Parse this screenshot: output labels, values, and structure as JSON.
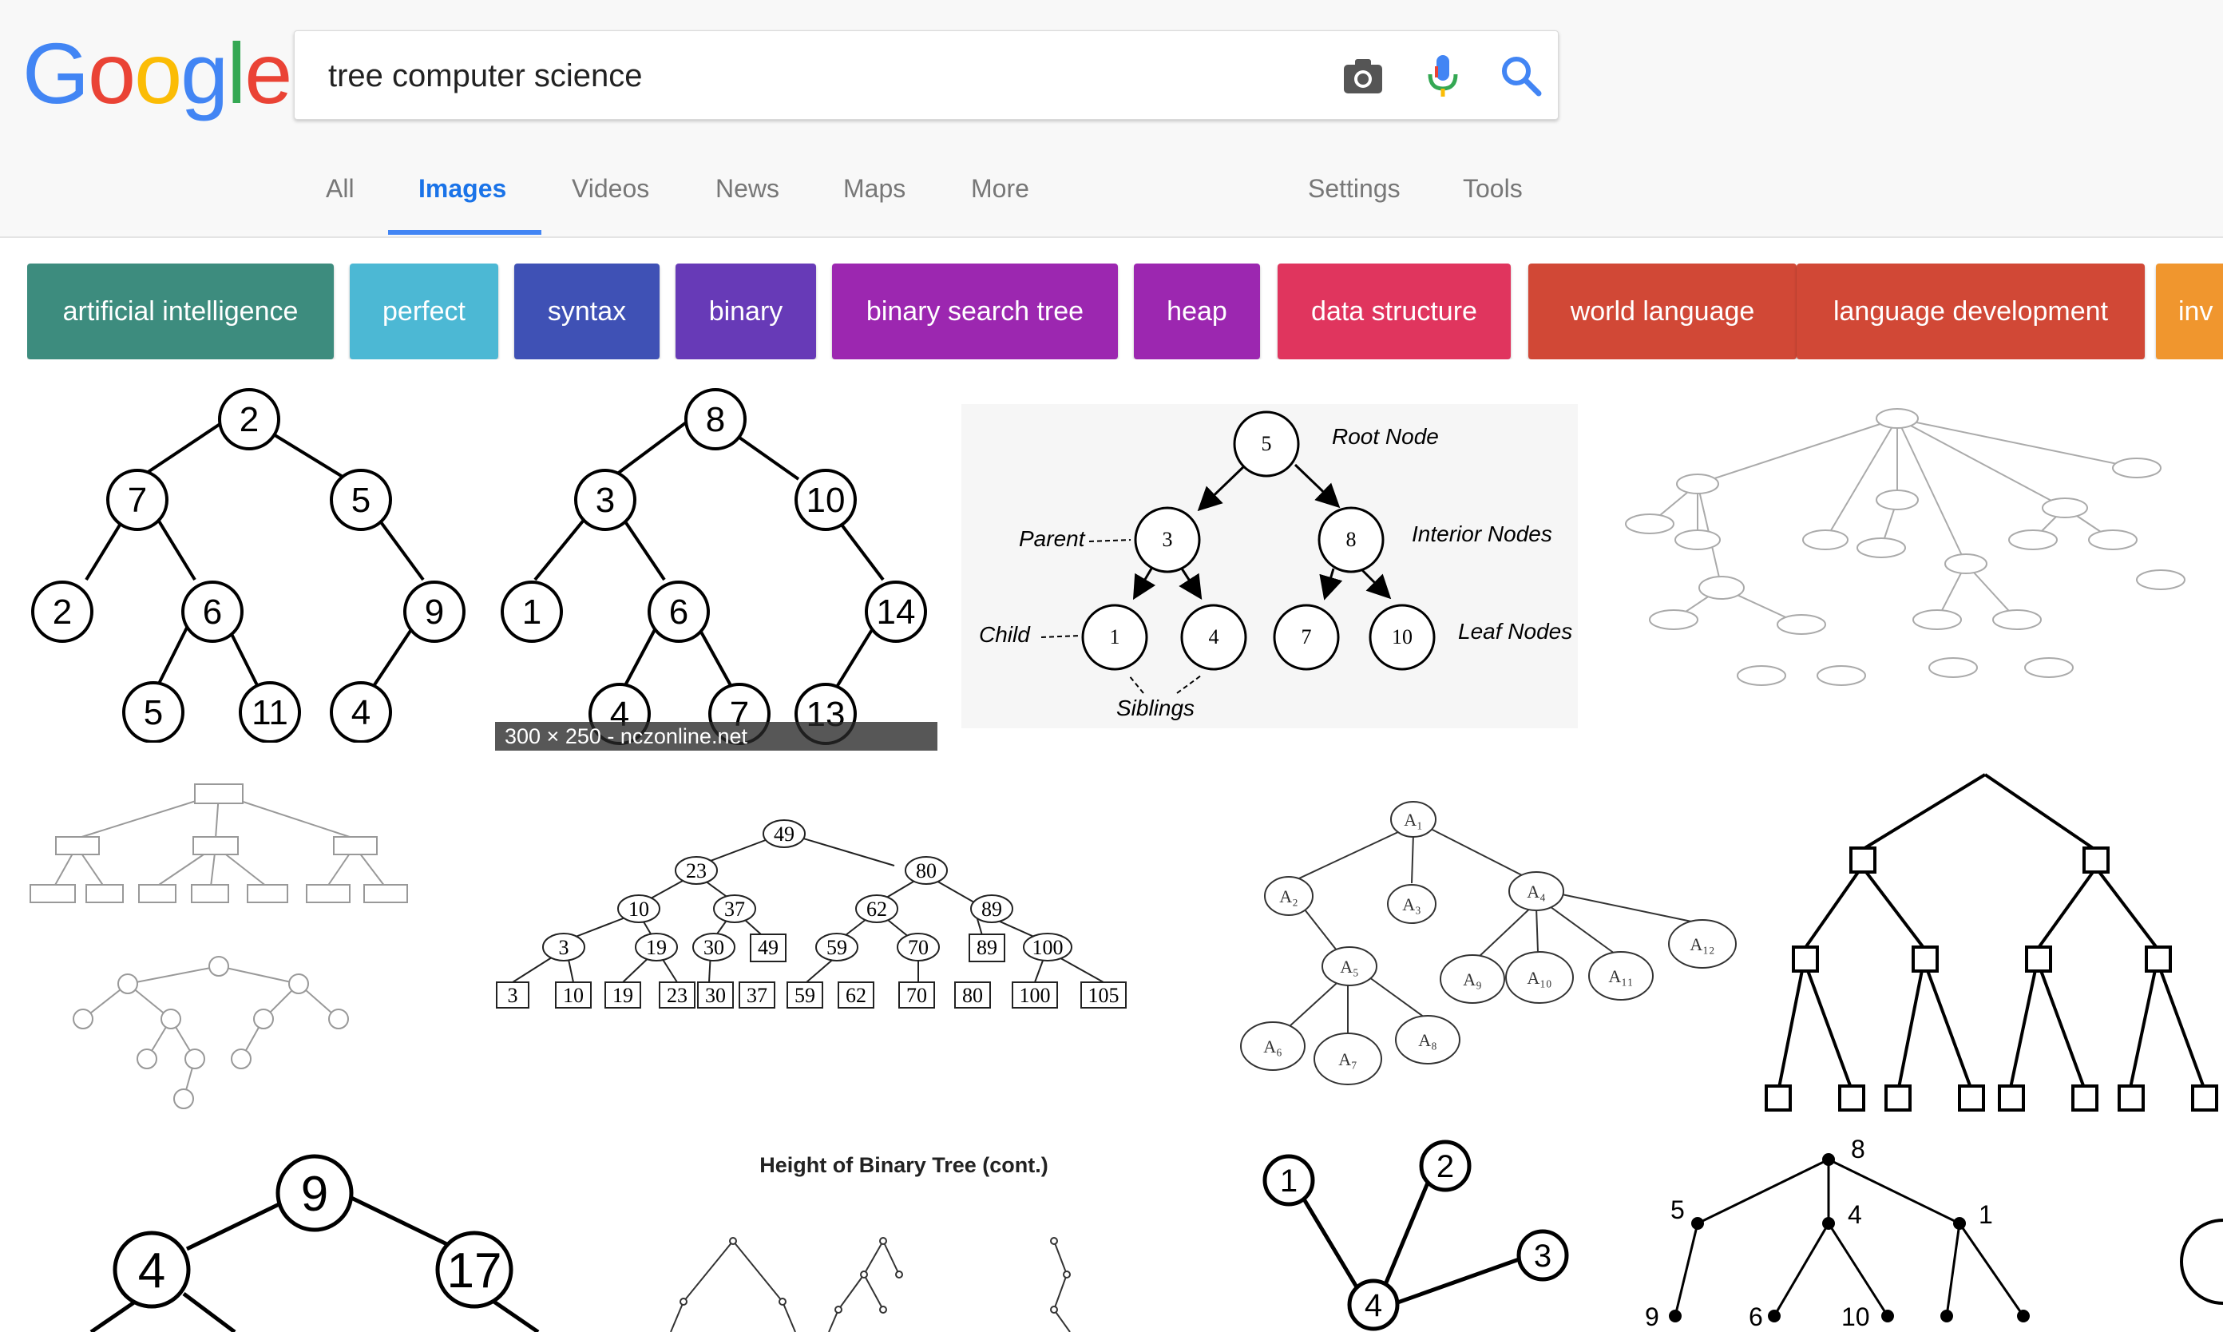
{
  "logo": {
    "letters": [
      "G",
      "o",
      "o",
      "g",
      "l",
      "e"
    ],
    "colors": [
      "#4285f4",
      "#ea4335",
      "#fbbc05",
      "#4285f4",
      "#34a853",
      "#ea4335"
    ]
  },
  "search": {
    "query": "tree computer science",
    "icons": [
      "camera-icon",
      "microphone-icon",
      "search-icon"
    ]
  },
  "tabs": {
    "all": "All",
    "images": "Images",
    "videos": "Videos",
    "news": "News",
    "maps": "Maps",
    "more": "More",
    "settings": "Settings",
    "tools": "Tools",
    "active": "Images"
  },
  "chips": [
    {
      "label": "artificial intelligence",
      "color": "#3d8c7e"
    },
    {
      "label": "perfect",
      "color": "#4cb8d4"
    },
    {
      "label": "syntax",
      "color": "#3f51b5"
    },
    {
      "label": "binary",
      "color": "#673ab7"
    },
    {
      "label": "binary search tree",
      "color": "#9c27b0"
    },
    {
      "label": "heap",
      "color": "#9c27b0"
    },
    {
      "label": "data structure",
      "color": "#e0355e"
    },
    {
      "label": "world language",
      "color": "#d14836"
    },
    {
      "label": "language development",
      "color": "#d14836"
    },
    {
      "label": "inv",
      "color": "#f0962e"
    }
  ],
  "results": {
    "hover_info": "300 × 250 - nczonline.net",
    "tree1": {
      "nodes": [
        "2",
        "7",
        "5",
        "2",
        "6",
        "9",
        "5",
        "11",
        "4"
      ]
    },
    "tree2": {
      "nodes": [
        "8",
        "3",
        "10",
        "1",
        "6",
        "14",
        "4",
        "7",
        "13"
      ]
    },
    "tree3": {
      "nodes": [
        "5",
        "3",
        "8",
        "1",
        "4",
        "7",
        "10"
      ],
      "labels": {
        "root": "Root Node",
        "interior": "Interior Nodes",
        "leaf": "Leaf Nodes",
        "parent": "Parent",
        "child": "Child",
        "siblings": "Siblings"
      }
    },
    "tree6": {
      "nodes": [
        "49",
        "23",
        "80",
        "10",
        "37",
        "62",
        "89",
        "3",
        "19",
        "30",
        "49",
        "59",
        "70",
        "89",
        "100"
      ],
      "leaves": [
        "3",
        "10",
        "19",
        "23",
        "30",
        "37",
        "59",
        "62",
        "70",
        "80",
        "100",
        "105"
      ]
    },
    "tree7": {
      "nodes": [
        "A₁",
        "A₂",
        "A₃",
        "A₄",
        "A₅",
        "A₆",
        "A₇",
        "A₈",
        "A₉",
        "A₁₀",
        "A₁₁",
        "A₁₂"
      ]
    },
    "tree9": {
      "nodes": [
        "9",
        "4",
        "17"
      ]
    },
    "tree10": {
      "title": "Height of Binary Tree (cont.)"
    },
    "tree11": {
      "nodes": [
        "1",
        "2",
        "3",
        "4"
      ]
    },
    "tree12": {
      "nodes": [
        "8",
        "5",
        "4",
        "1",
        "9",
        "6",
        "10"
      ]
    }
  }
}
